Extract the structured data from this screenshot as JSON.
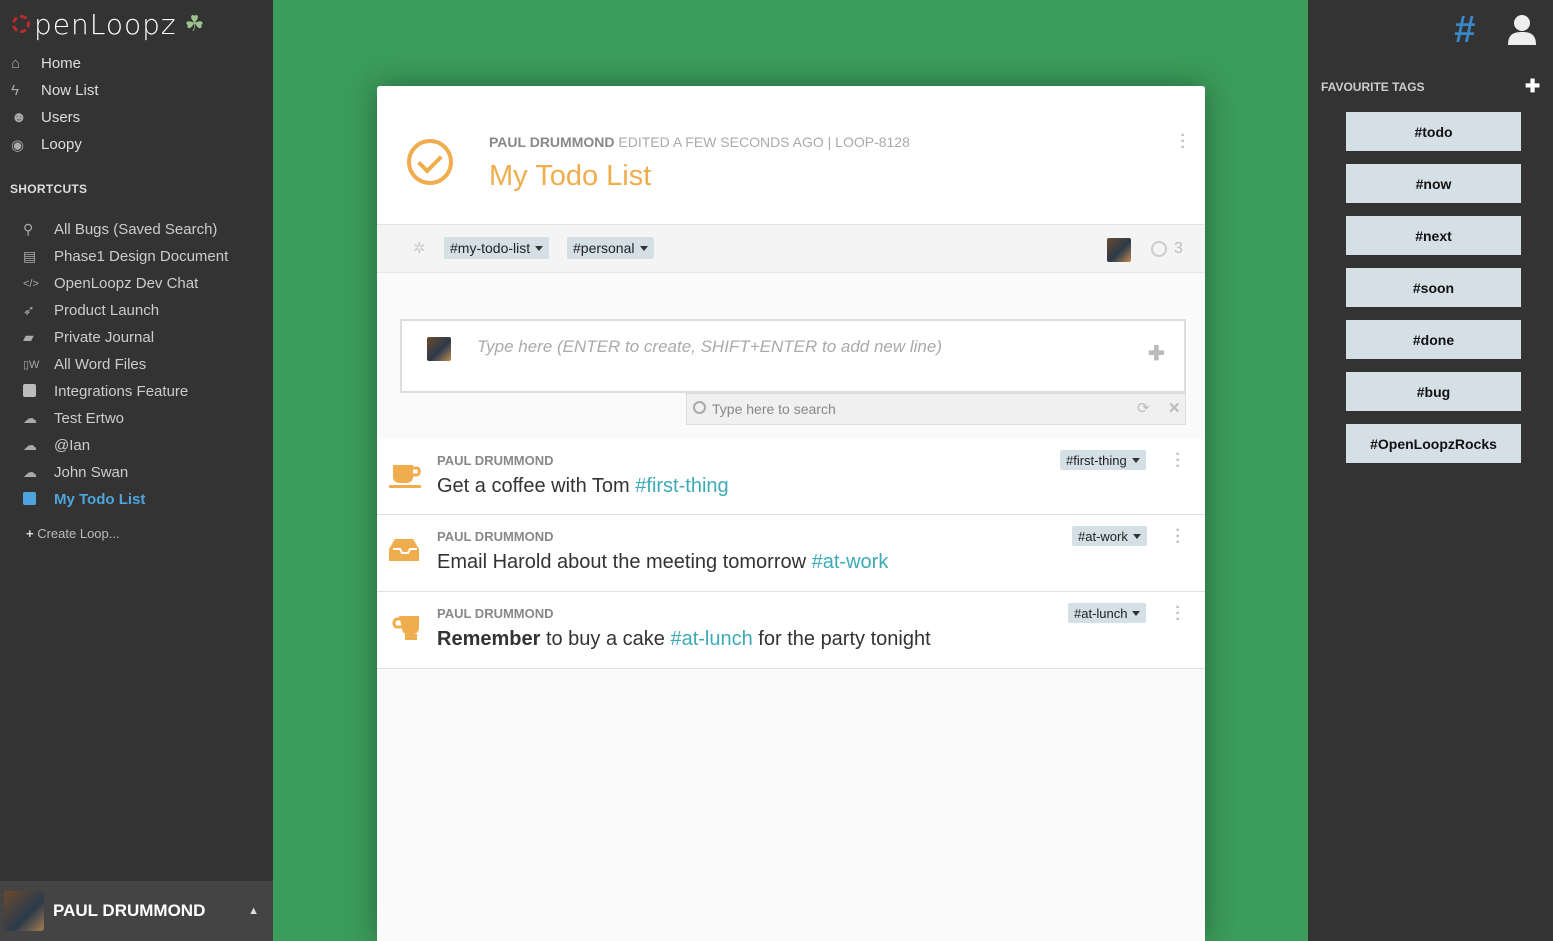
{
  "app": {
    "logo_text": "penLoopz"
  },
  "sidebar": {
    "nav": [
      {
        "label": "Home",
        "icon": "home-icon",
        "glyph": "⌂"
      },
      {
        "label": "Now List",
        "icon": "bolt-icon",
        "glyph": "ϟ"
      },
      {
        "label": "Users",
        "icon": "users-icon",
        "glyph": "☻"
      },
      {
        "label": "Loopy",
        "icon": "loopy-icon",
        "glyph": "◉"
      }
    ],
    "shortcuts_title": "SHORTCUTS",
    "shortcuts": [
      {
        "label": "All Bugs (Saved Search)",
        "icon": "search-icon",
        "glyph": "⚲"
      },
      {
        "label": "Phase1 Design Document",
        "icon": "document-icon",
        "glyph": "▤"
      },
      {
        "label": "OpenLoopz Dev Chat",
        "icon": "code-icon",
        "glyph": "</>"
      },
      {
        "label": "Product Launch",
        "icon": "rocket-icon",
        "glyph": "➶"
      },
      {
        "label": "Private Journal",
        "icon": "book-icon",
        "glyph": "▰"
      },
      {
        "label": "All Word Files",
        "icon": "word-file-icon",
        "glyph": "W"
      },
      {
        "label": "Integrations Feature",
        "icon": "square-icon",
        "glyph": ""
      },
      {
        "label": "Test Ertwo",
        "icon": "chat-icon",
        "glyph": "☁"
      },
      {
        "label": "@Ian",
        "icon": "chat-icon",
        "glyph": "☁"
      },
      {
        "label": "John Swan",
        "icon": "chat-icon",
        "glyph": "☁"
      },
      {
        "label": "My Todo List",
        "icon": "square-icon",
        "glyph": ""
      }
    ],
    "create_loop": "Create Loop...",
    "user_name": "PAUL DRUMMOND"
  },
  "rightbar": {
    "favourite_title": "FAVOURITE TAGS",
    "tags": [
      "#todo",
      "#now",
      "#next",
      "#soon",
      "#done",
      "#bug",
      "#OpenLoopzRocks"
    ]
  },
  "card": {
    "author": "PAUL DRUMMOND",
    "meta_rest": "EDITED A FEW SECONDS AGO | LOOP-8128",
    "title": "My Todo List",
    "tags": [
      "#my-todo-list",
      "#personal"
    ],
    "count": "3",
    "composer_placeholder": "Type here (ENTER to create, SHIFT+ENTER to add new line)",
    "search_placeholder": "Type here to search",
    "items": [
      {
        "author": "PAUL DRUMMOND",
        "text_before": "Get a coffee with Tom ",
        "bold": "",
        "hashtag": "#first-thing",
        "text_after": "",
        "tag": "#first-thing",
        "icon": "coffee-icon"
      },
      {
        "author": "PAUL DRUMMOND",
        "text_before": "Email Harold about the meeting tomorrow ",
        "bold": "",
        "hashtag": "#at-work",
        "text_after": "",
        "tag": "#at-work",
        "icon": "inbox-icon"
      },
      {
        "author": "PAUL DRUMMOND",
        "text_before": " to buy a cake ",
        "bold": "Remember",
        "hashtag": "#at-lunch",
        "text_after": " for the party tonight",
        "tag": "#at-lunch",
        "icon": "mug-icon"
      }
    ]
  },
  "colors": {
    "accent": "#f0ad4e",
    "hashtag": "#3eaab6",
    "link_active": "#4ea4dc",
    "background": "#3b9c5b"
  }
}
